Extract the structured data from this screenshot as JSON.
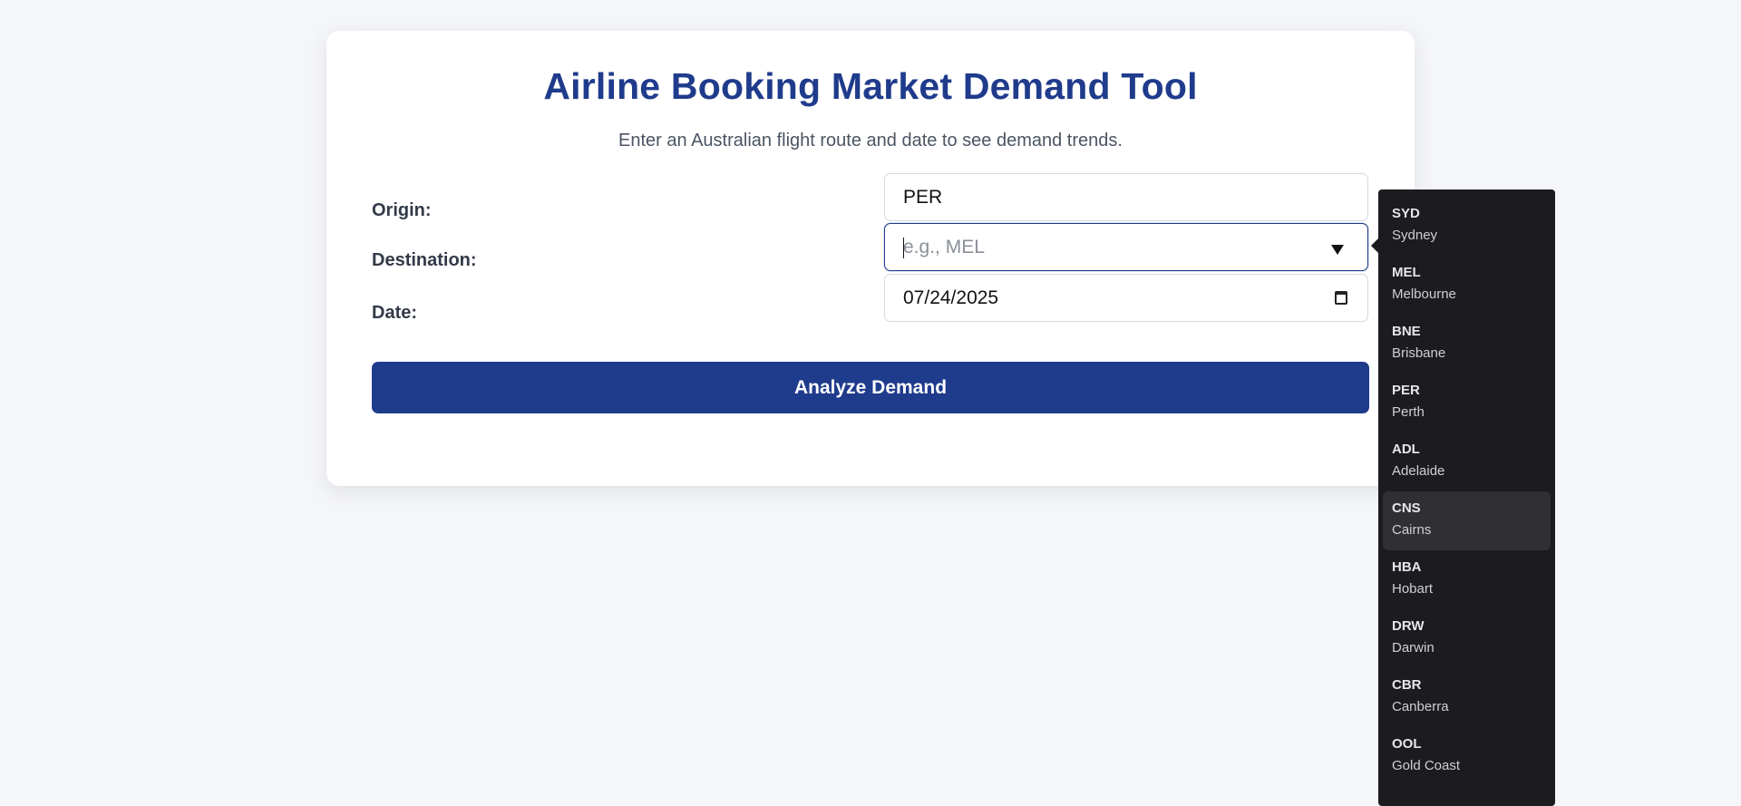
{
  "title": "Airline Booking Market Demand Tool",
  "subtitle": "Enter an Australian flight route and date to see demand trends.",
  "form": {
    "origin_label": "Origin:",
    "origin_value": "PER",
    "destination_label": "Destination:",
    "destination_value": "",
    "destination_placeholder": "e.g., MEL",
    "date_label": "Date:",
    "date_value": "07/24/2025",
    "submit_label": "Analyze Demand"
  },
  "dropdown": {
    "highlighted": "CNS",
    "options": [
      {
        "code": "SYD",
        "city": "Sydney"
      },
      {
        "code": "MEL",
        "city": "Melbourne"
      },
      {
        "code": "BNE",
        "city": "Brisbane"
      },
      {
        "code": "PER",
        "city": "Perth"
      },
      {
        "code": "ADL",
        "city": "Adelaide"
      },
      {
        "code": "CNS",
        "city": "Cairns"
      },
      {
        "code": "HBA",
        "city": "Hobart"
      },
      {
        "code": "DRW",
        "city": "Darwin"
      },
      {
        "code": "CBR",
        "city": "Canberra"
      },
      {
        "code": "OOL",
        "city": "Gold Coast"
      }
    ]
  },
  "colors": {
    "accent": "#1f3b8c",
    "page_background": "#f5f6f9",
    "dropdown_background": "#1c1c20",
    "dropdown_hover": "#2f2f34"
  }
}
